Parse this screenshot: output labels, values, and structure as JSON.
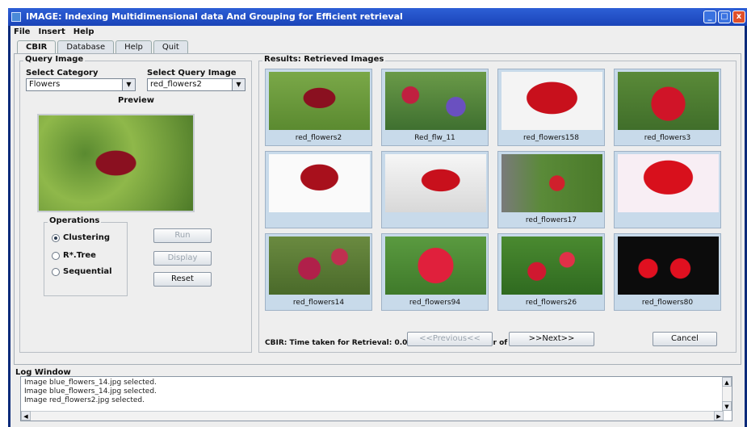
{
  "window": {
    "title": "IMAGE: Indexing Multidimensional data And Grouping for Efficient retrieval",
    "min_icon": "_",
    "max_icon": "□",
    "close_icon": "x"
  },
  "menu": [
    "File",
    "Insert",
    "Help"
  ],
  "tabs": [
    {
      "label": "CBIR"
    },
    {
      "label": "Database"
    },
    {
      "label": "Help"
    },
    {
      "label": "Quit"
    }
  ],
  "query": {
    "group_title": "Query Image",
    "category_label": "Select Category",
    "category_value": "Flowers",
    "image_label": "Select Query Image",
    "image_value": "red_flowers2",
    "preview_label": "Preview"
  },
  "operations": {
    "title": "Operations",
    "options": [
      "Clustering",
      "R*.Tree",
      "Sequential"
    ],
    "selected": "Clustering",
    "run_label": "Run",
    "display_label": "Display",
    "reset_label": "Reset"
  },
  "results": {
    "title": "Results: Retrieved Images",
    "items": [
      {
        "caption": "red_flowers2"
      },
      {
        "caption": "Red_flw_11"
      },
      {
        "caption": "red_flowers158"
      },
      {
        "caption": "red_flowers3"
      },
      {
        "caption": ""
      },
      {
        "caption": ""
      },
      {
        "caption": "red_flowers17"
      },
      {
        "caption": ""
      },
      {
        "caption": "red_flowers14"
      },
      {
        "caption": "red_flowers94"
      },
      {
        "caption": "red_flowers26"
      },
      {
        "caption": "red_flowers80"
      }
    ],
    "status": "CBIR: Time taken for Retrieval: 0.016 seconds... Number of Images Selected 13",
    "prev_label": "<<Previous<<",
    "next_label": ">>Next>>",
    "cancel_label": "Cancel"
  },
  "log": {
    "title": "Log Window",
    "lines": [
      "Image blue_flowers_14.jpg selected.",
      "Image blue_flowers_14.jpg selected.",
      "Image red_flowers2.jpg selected."
    ]
  }
}
